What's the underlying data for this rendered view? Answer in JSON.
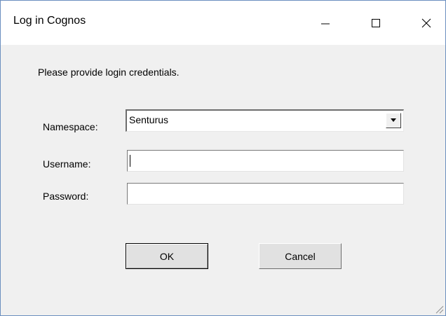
{
  "window": {
    "title": "Log in Cognos"
  },
  "dialog": {
    "prompt": "Please provide login credentials.",
    "namespace": {
      "label": "Namespace:",
      "selected": "Senturus"
    },
    "username": {
      "label": "Username:",
      "value": ""
    },
    "password": {
      "label": "Password:",
      "value": ""
    },
    "ok_label": "OK",
    "cancel_label": "Cancel"
  },
  "colors": {
    "window_border": "#6b8fbf",
    "client_bg": "#f0f0f0",
    "titlebar_bg": "#ffffff",
    "button_face": "#e1e1e1"
  },
  "icons": {
    "minimize": "minimize-icon",
    "maximize": "maximize-icon",
    "close": "close-icon",
    "dropdown": "dropdown-arrow-icon",
    "resize": "resize-grip-icon"
  }
}
